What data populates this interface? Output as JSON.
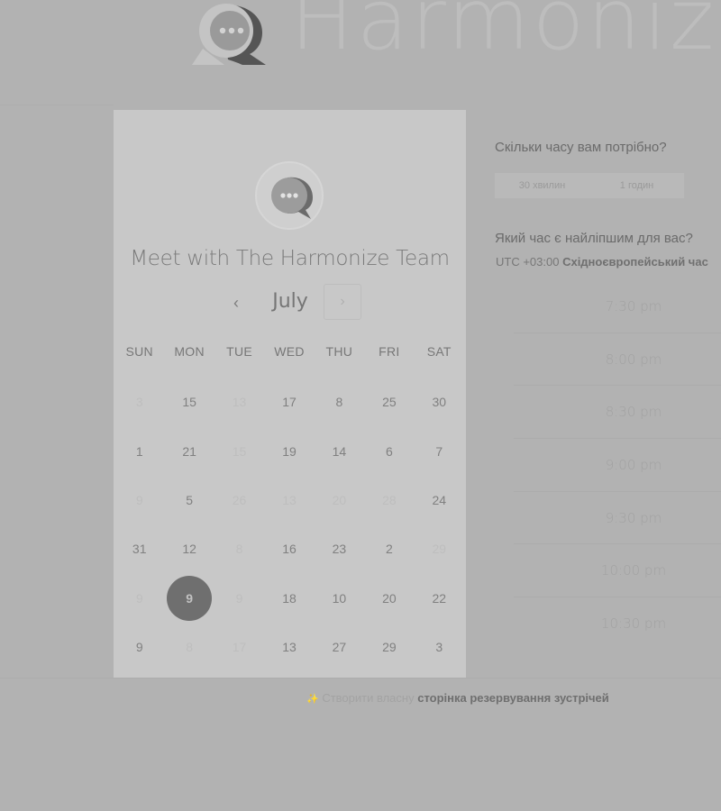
{
  "header": {
    "brand": "Harmonize",
    "logo_icon": "chat-bubble-logo-icon"
  },
  "calendar": {
    "host_title": "Meet with The Harmonize Team",
    "month": "July",
    "prev_icon": "chevron-left-icon",
    "prev_glyph": "‹",
    "next_icon": "chevron-right-icon",
    "next_glyph": "›",
    "weekdays": [
      "SUN",
      "MON",
      "TUE",
      "WED",
      "THU",
      "FRI",
      "SAT"
    ],
    "weeks": [
      [
        {
          "d": "3",
          "f": true
        },
        {
          "d": "15",
          "f": false
        },
        {
          "d": "13",
          "f": true
        },
        {
          "d": "17",
          "f": false
        },
        {
          "d": "8",
          "f": false
        },
        {
          "d": "25",
          "f": false
        },
        {
          "d": "30",
          "f": false
        }
      ],
      [
        {
          "d": "1",
          "f": false
        },
        {
          "d": "21",
          "f": false
        },
        {
          "d": "15",
          "f": true
        },
        {
          "d": "19",
          "f": false
        },
        {
          "d": "14",
          "f": false
        },
        {
          "d": "6",
          "f": false
        },
        {
          "d": "7",
          "f": false
        }
      ],
      [
        {
          "d": "9",
          "f": true
        },
        {
          "d": "5",
          "f": false
        },
        {
          "d": "26",
          "f": true
        },
        {
          "d": "13",
          "f": true
        },
        {
          "d": "20",
          "f": true
        },
        {
          "d": "28",
          "f": true
        },
        {
          "d": "24",
          "f": false
        }
      ],
      [
        {
          "d": "31",
          "f": false
        },
        {
          "d": "12",
          "f": false
        },
        {
          "d": "8",
          "f": true
        },
        {
          "d": "16",
          "f": false
        },
        {
          "d": "23",
          "f": false
        },
        {
          "d": "2",
          "f": false
        },
        {
          "d": "29",
          "f": true
        }
      ],
      [
        {
          "d": "9",
          "f": true
        },
        {
          "d": "9",
          "f": false,
          "selected": true
        },
        {
          "d": "9",
          "f": true
        },
        {
          "d": "18",
          "f": false
        },
        {
          "d": "10",
          "f": false
        },
        {
          "d": "20",
          "f": false
        },
        {
          "d": "22",
          "f": false
        }
      ],
      [
        {
          "d": "9",
          "f": false
        },
        {
          "d": "8",
          "f": true
        },
        {
          "d": "17",
          "f": true
        },
        {
          "d": "13",
          "f": false
        },
        {
          "d": "27",
          "f": false
        },
        {
          "d": "29",
          "f": false
        },
        {
          "d": "3",
          "f": false
        }
      ]
    ]
  },
  "booking": {
    "duration_question": "Скільки часу вам потрібно?",
    "durations": [
      "30 хвилин",
      "1 годин"
    ],
    "time_question": "Який час є найліпшим для вас?",
    "timezone_offset": "UTC +03:00",
    "timezone_name": "Східноєвропейський час",
    "slots": [
      "7:30 pm",
      "8:00 pm",
      "8:30 pm",
      "9:00 pm",
      "9:30 pm",
      "10:00 pm",
      "10:30 pm"
    ]
  },
  "footer": {
    "icon": "sparkle-icon",
    "icon_glyph": "✨",
    "prefix": "Створити власну",
    "link": "сторінка резервування зустрічей"
  }
}
